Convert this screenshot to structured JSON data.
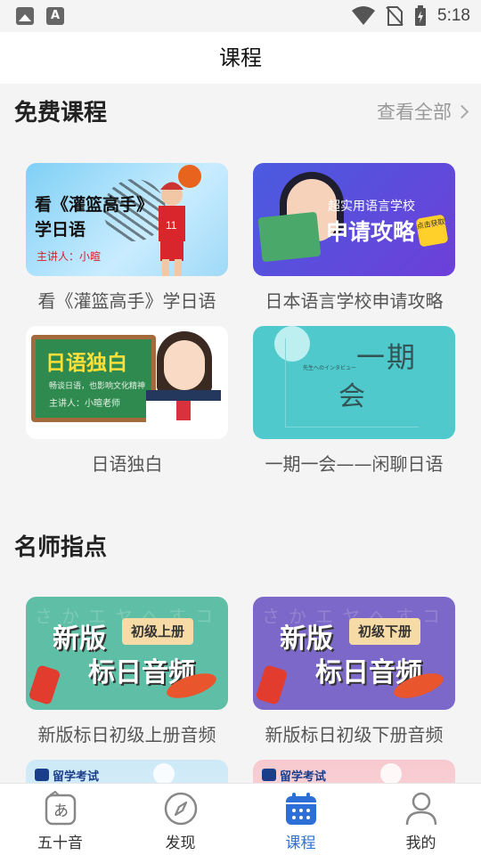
{
  "status_bar": {
    "time": "5:18",
    "left_icons": [
      "image-icon",
      "text-a-icon"
    ],
    "right_icons": [
      "wifi-icon",
      "no-sim-icon",
      "battery-charging-icon"
    ]
  },
  "header": {
    "title": "课程"
  },
  "sections": {
    "free": {
      "title": "免费课程",
      "more_label": "查看全部",
      "courses": [
        {
          "caption": "看《灌篮高手》学日语",
          "thumb_line1": "看《灌篮高手》",
          "thumb_line2": "学日语",
          "thumb_line3": "主讲人：小暄"
        },
        {
          "caption": "日本语言学校申请攻略",
          "thumb_line1": "超实用语言学校",
          "thumb_line2": "申请攻略",
          "thumb_badge": "点击获取"
        },
        {
          "caption": "日语独白",
          "thumb_line1": "日语独白",
          "thumb_line2": "畅谈日语，也影响文化精神",
          "thumb_line3": "主讲人：小暄老师"
        },
        {
          "caption": "一期一会——闲聊日语",
          "thumb_line1": "一期",
          "thumb_line2": "会",
          "thumb_line3": "先生へのインタビュー"
        }
      ]
    },
    "teacher": {
      "title": "名师指点",
      "courses": [
        {
          "caption": "新版标日初级上册音频",
          "thumb_line1": "新版",
          "thumb_line2": "标日音频",
          "thumb_tag": "初级上册",
          "thumb_kana": "さかエヤへすコ"
        },
        {
          "caption": "新版标日初级下册音频",
          "thumb_line1": "新版",
          "thumb_line2": "标日音频",
          "thumb_tag": "初级下册",
          "thumb_kana": "さかエヤへすコ"
        },
        {
          "caption": "",
          "thumb_tag": "留学考试"
        },
        {
          "caption": "",
          "thumb_tag": "留学考试"
        }
      ]
    }
  },
  "bottom_nav": {
    "items": [
      {
        "label": "五十音",
        "icon": "kana-book-icon",
        "active": false
      },
      {
        "label": "发现",
        "icon": "compass-icon",
        "active": false
      },
      {
        "label": "课程",
        "icon": "calendar-icon",
        "active": true
      },
      {
        "label": "我的",
        "icon": "person-icon",
        "active": false
      }
    ]
  },
  "colors": {
    "accent": "#2c6fd6",
    "background": "#f4f4f4",
    "muted": "#999999"
  }
}
